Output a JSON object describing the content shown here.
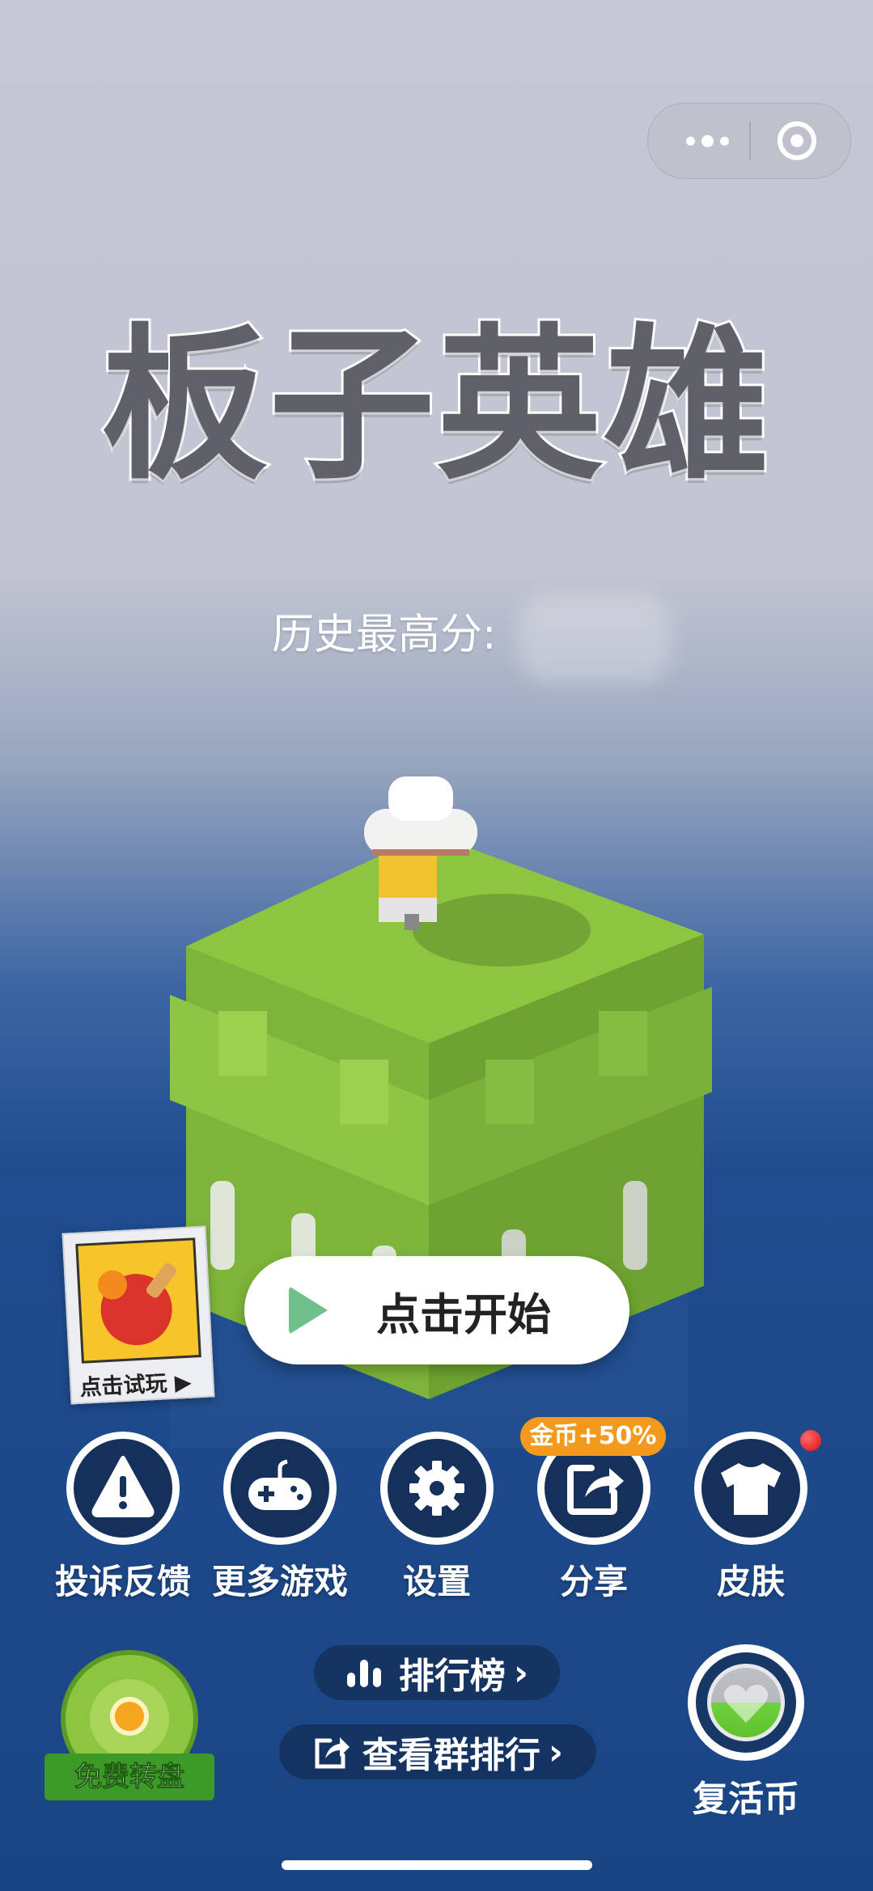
{
  "capsule": {
    "menu_icon": "more-dots-icon",
    "close_icon": "target-close-icon"
  },
  "title": "板子英雄",
  "best_score_label": "历史最高分:",
  "trial": {
    "label": "点击试玩 ▶",
    "icon": "ping-pong-paddle-icon"
  },
  "start_label": "点击开始",
  "row_buttons": [
    {
      "label": "投诉反馈",
      "icon": "warning-icon"
    },
    {
      "label": "更多游戏",
      "icon": "gamepad-icon"
    },
    {
      "label": "设置",
      "icon": "gear-icon"
    },
    {
      "label": "分享",
      "icon": "share-icon"
    },
    {
      "label": "皮肤",
      "icon": "tshirt-icon"
    }
  ],
  "share_badge": "金币+50%",
  "leaderboard_label": "排行榜",
  "group_rank_label": "查看群排行",
  "wheel_label": "免费转盘",
  "revive_label": "复活币",
  "colors": {
    "start_play": "#6fc08a",
    "badge": "#f39a1c",
    "icon_bg": "#15305a",
    "cube_green": "#8cc63f"
  }
}
